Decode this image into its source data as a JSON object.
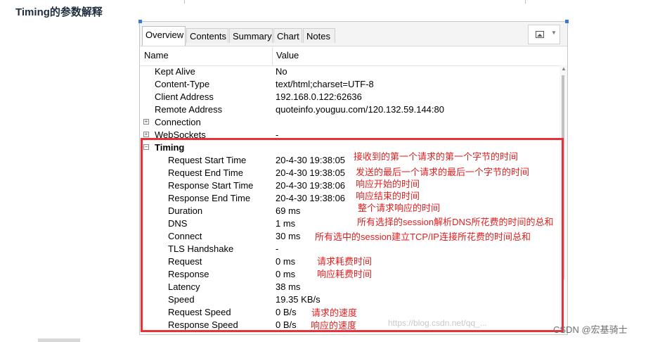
{
  "page": {
    "heading": "Timing的参数解释",
    "watermark_url": "https://blog.csdn.net/qq_...",
    "watermark_csdn": "CSDN @宏基骑士"
  },
  "tabs": [
    "Overview",
    "Contents",
    "Summary",
    "Chart",
    "Notes"
  ],
  "active_tab": "Overview",
  "table": {
    "col_name": "Name",
    "col_value": "Value"
  },
  "rows": [
    {
      "name": "Kept Alive",
      "value": "No",
      "level": 1
    },
    {
      "name": "Content-Type",
      "value": "text/html;charset=UTF-8",
      "level": 1
    },
    {
      "name": "Client Address",
      "value": "192.168.0.122:62636",
      "level": 1
    },
    {
      "name": "Remote Address",
      "value": "quoteinfo.youguu.com/120.132.59.144:80",
      "level": 1
    },
    {
      "name": "Connection",
      "value": "",
      "level": 1,
      "expander": "+"
    },
    {
      "name": "WebSockets",
      "value": "-",
      "level": 1,
      "expander": "+"
    },
    {
      "name": "Timing",
      "value": "",
      "level": 1,
      "expander": "−",
      "bold": true
    },
    {
      "name": "Request Start Time",
      "value": "20-4-30 19:38:05",
      "level": 2
    },
    {
      "name": "Request End Time",
      "value": "20-4-30 19:38:05",
      "level": 2
    },
    {
      "name": "Response Start Time",
      "value": "20-4-30 19:38:06",
      "level": 2
    },
    {
      "name": "Response End Time",
      "value": "20-4-30 19:38:06",
      "level": 2
    },
    {
      "name": "Duration",
      "value": "69 ms",
      "level": 2
    },
    {
      "name": "DNS",
      "value": "1 ms",
      "level": 2
    },
    {
      "name": "Connect",
      "value": "30 ms",
      "level": 2
    },
    {
      "name": "TLS Handshake",
      "value": "-",
      "level": 2
    },
    {
      "name": "Request",
      "value": "0 ms",
      "level": 2
    },
    {
      "name": "Response",
      "value": "0 ms",
      "level": 2
    },
    {
      "name": "Latency",
      "value": "38 ms",
      "level": 2
    },
    {
      "name": "Speed",
      "value": "19.35 KB/s",
      "level": 2
    },
    {
      "name": "Request Speed",
      "value": "0 B/s",
      "level": 2
    },
    {
      "name": "Response Speed",
      "value": "0 B/s",
      "level": 2
    }
  ],
  "annotations": [
    "接收到的第一个请求的第一个字节的时间",
    "发送的最后一个请求的最后一个字节的时间",
    "响应开始的时间",
    "响应结束的时间",
    "整个请求响应的时间",
    "所有选择的session解析DNS所花费的时间的总和",
    "所有选中的session建立TCP/IP连接所花费的时间总和",
    "请求耗费时间",
    "响应耗费时间",
    "请求的速度",
    "响应的速度"
  ],
  "colors": {
    "annotation": "#e02020",
    "highlight_box": "#e8323a",
    "selection": "#3a79d6"
  }
}
